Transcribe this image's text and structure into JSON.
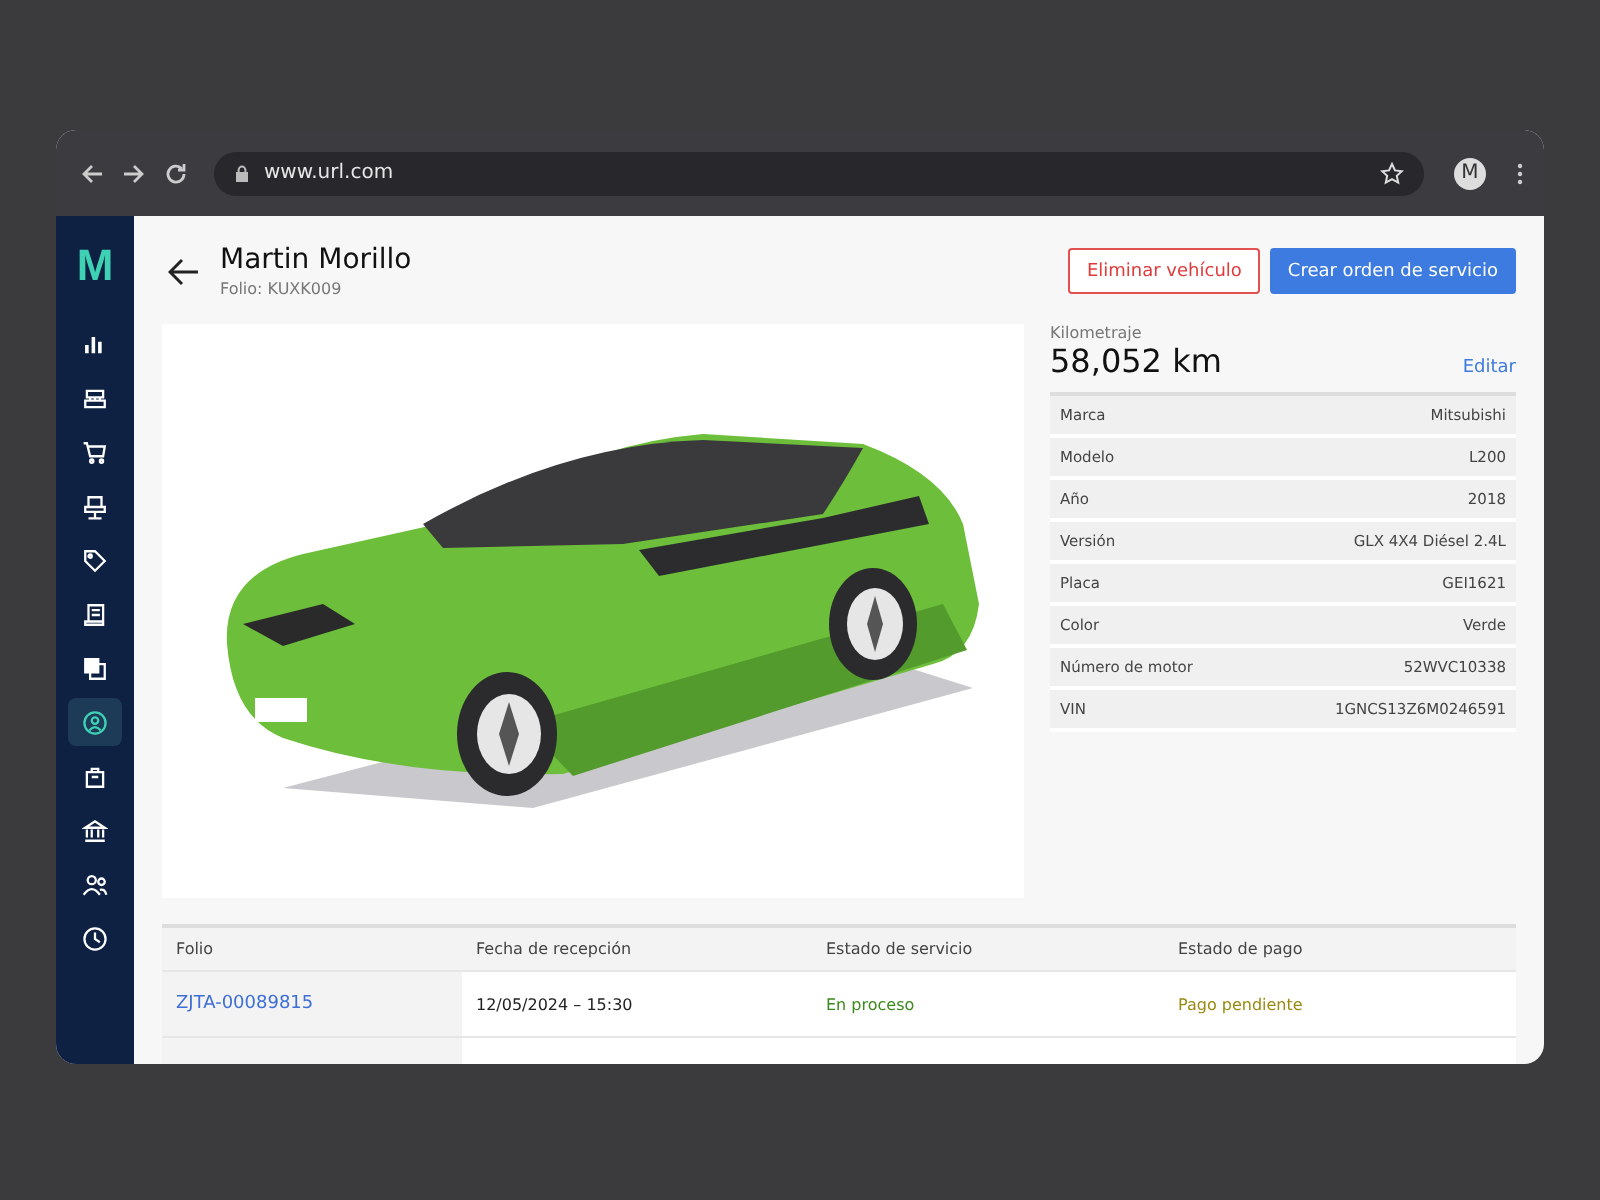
{
  "browser": {
    "url": "www.url.com",
    "profile_initial": "M"
  },
  "sidebar": {
    "logo": "M",
    "items": [
      {
        "selected": false
      },
      {
        "selected": false
      },
      {
        "selected": false
      },
      {
        "selected": false
      },
      {
        "selected": false
      },
      {
        "selected": false
      },
      {
        "selected": false
      },
      {
        "selected": true
      },
      {
        "selected": false
      },
      {
        "selected": false
      },
      {
        "selected": false
      },
      {
        "selected": false
      }
    ]
  },
  "header": {
    "title": "Martin Morillo",
    "subtitle": "Folio: KUXK009",
    "buttons": [
      {
        "label": "Eliminar vehículo",
        "kind": "danger"
      },
      {
        "label": "Crear orden de servicio",
        "kind": "primary"
      }
    ]
  },
  "mileage": {
    "label": "Kilometraje",
    "value": "58,052 km",
    "action": "Editar"
  },
  "details": [
    {
      "label": "Marca",
      "value": "Mitsubishi"
    },
    {
      "label": "Modelo",
      "value": "L200"
    },
    {
      "label": "Año",
      "value": "2018"
    },
    {
      "label": "Versión",
      "value": "GLX 4X4 Diésel 2.4L"
    },
    {
      "label": "Placa",
      "value": "GEI1621"
    },
    {
      "label": "Color",
      "value": "Verde"
    },
    {
      "label": "Número de motor",
      "value": "52WVC10338"
    },
    {
      "label": "VIN",
      "value": "1GNCS13Z6M0246591"
    }
  ],
  "table": {
    "columns": [
      "Folio",
      "Fecha de recepción",
      "Estado de servicio",
      "Estado de pago"
    ],
    "rows": [
      {
        "folio": "ZJTA-00089815",
        "date": "12/05/2024 – 15:30",
        "service_status": {
          "text": "En proceso",
          "color": "#3d8a1c"
        },
        "payment_status": {
          "text": "Pago pendiente",
          "color": "#9a8a12"
        }
      }
    ]
  }
}
